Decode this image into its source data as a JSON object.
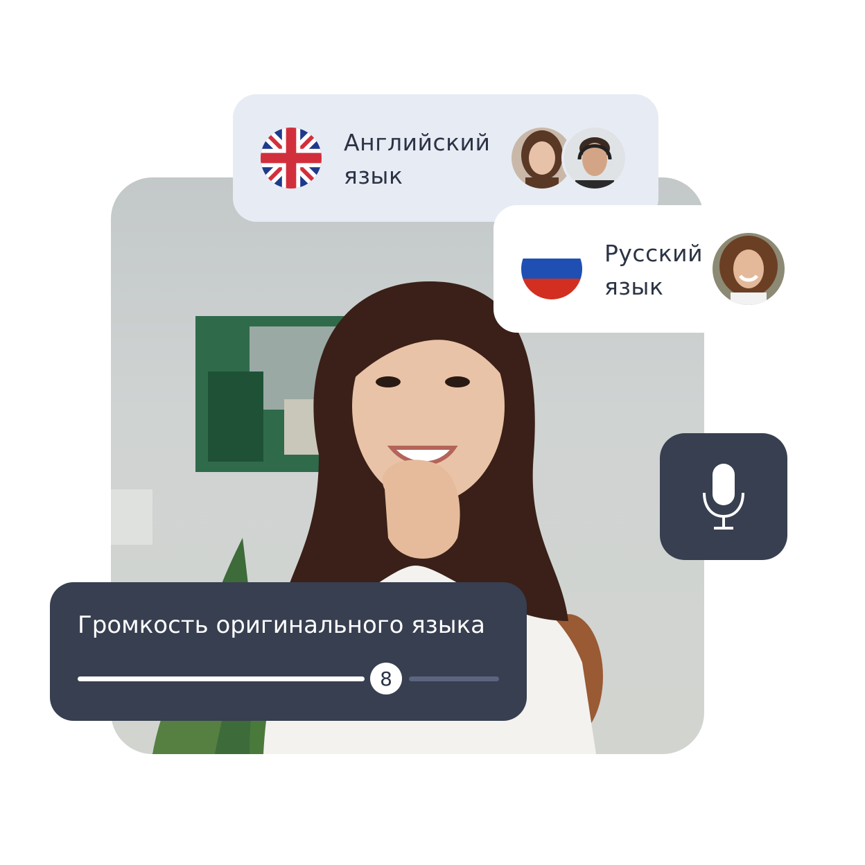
{
  "languages": {
    "english": {
      "line1": "Английский",
      "line2": "язык"
    },
    "russian": {
      "line1": "Русский",
      "line2": "язык"
    }
  },
  "microphone": {
    "icon": "microphone-icon"
  },
  "volume": {
    "title": "Громкость оригинального языка",
    "value": "8",
    "level_fraction": 0.8
  },
  "colors": {
    "panel_dark": "#373f50",
    "card_light": "#e7ebf4",
    "text_dark": "#2b3345"
  }
}
